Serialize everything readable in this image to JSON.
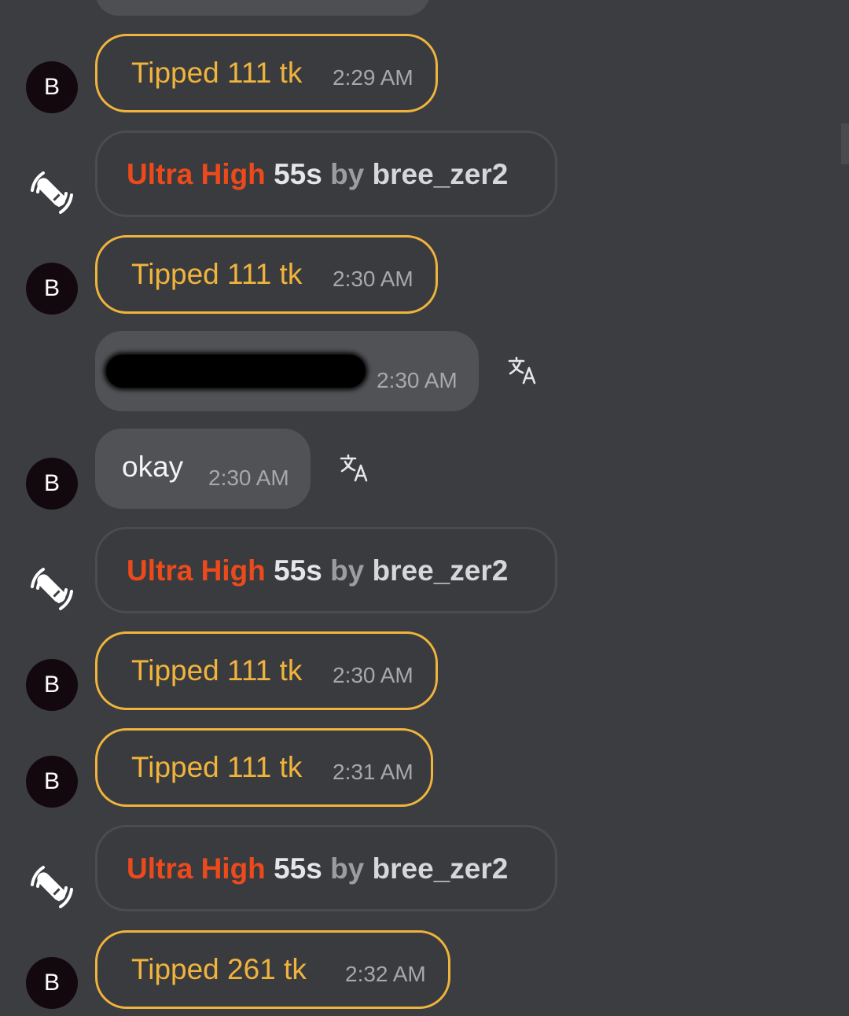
{
  "avatar_initial": "B",
  "messages": [
    {
      "type": "tip",
      "text": "Tipped 111 tk",
      "time": "2:29 AM"
    },
    {
      "type": "vibe",
      "level": "Ultra High",
      "duration": "55s",
      "by": "by",
      "user": "bree_zer2"
    },
    {
      "type": "tip",
      "text": "Tipped 111 tk",
      "time": "2:30 AM"
    },
    {
      "type": "text",
      "text": "",
      "redacted": true,
      "time": "2:30 AM"
    },
    {
      "type": "text",
      "text": "okay",
      "time": "2:30 AM"
    },
    {
      "type": "vibe",
      "level": "Ultra High",
      "duration": "55s",
      "by": "by",
      "user": "bree_zer2"
    },
    {
      "type": "tip",
      "text": "Tipped 111 tk",
      "time": "2:30 AM"
    },
    {
      "type": "tip",
      "text": "Tipped 111 tk",
      "time": "2:31 AM"
    },
    {
      "type": "vibe",
      "level": "Ultra High",
      "duration": "55s",
      "by": "by",
      "user": "bree_zer2"
    },
    {
      "type": "tip",
      "text": "Tipped 261 tk",
      "time": "2:32 AM"
    }
  ],
  "icons": {
    "avatar": "user-avatar-initial",
    "vibe": "vibrator-icon",
    "translate": "translate-icon"
  },
  "colors": {
    "background": "#3c3d41",
    "tip_accent": "#f0b43c",
    "vibe_level": "#ed4a1c",
    "avatar_bg": "#14080f"
  }
}
